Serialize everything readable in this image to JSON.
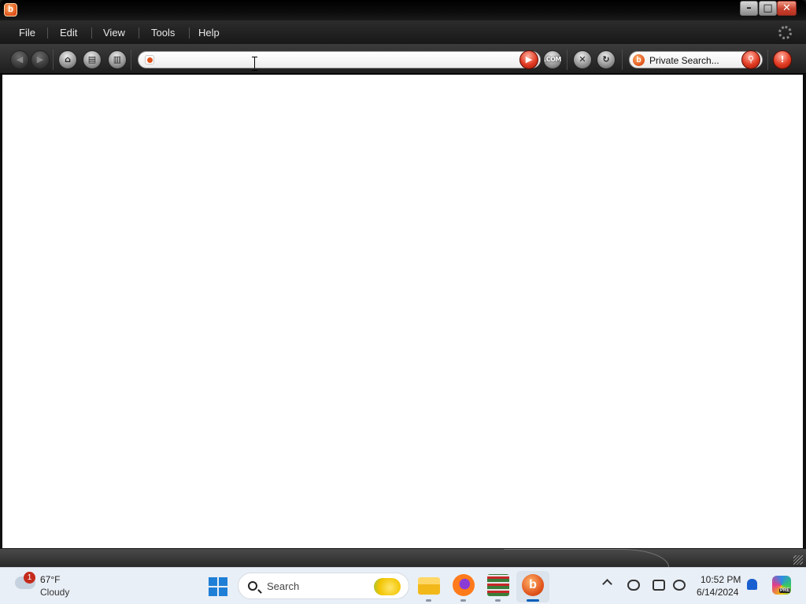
{
  "window": {
    "logo": "b",
    "controls": {
      "minimize": "–",
      "maximize": "□",
      "close": "✕"
    }
  },
  "menu": [
    "File",
    "Edit",
    "View",
    "Tools",
    "Help"
  ],
  "toolbar": {
    "back": "◀",
    "forward": "▶",
    "home": "⌂",
    "print": "▤",
    "history": "▥",
    "address_value": "",
    "go": "▶",
    "com": ".COM",
    "stop": "✕",
    "refresh": "↻",
    "search_logo": "b",
    "search_placeholder": "Private Search...",
    "search_go": "⚲",
    "alert": "!"
  },
  "taskbar": {
    "weather": {
      "badge": "1",
      "temp": "67°F",
      "condition": "Cloudy"
    },
    "search_label": "Search",
    "browser_letter": "b",
    "time": "10:52 PM",
    "date": "6/14/2024",
    "copilot_badge": "PRE"
  }
}
